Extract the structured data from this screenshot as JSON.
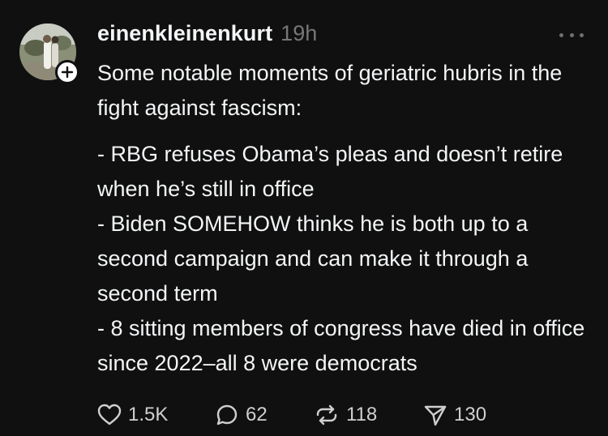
{
  "post": {
    "username": "einenkleinenkurt",
    "timestamp": "19h",
    "text": {
      "intro": "Some notable moments of geriatric hubris in the fight against fascism:",
      "items": [
        "- RBG refuses Obama’s pleas and doesn’t retire when he’s still in office",
        "- Biden SOMEHOW thinks he is both up to a second campaign and can make it through a second term",
        "- 8 sitting members of congress have died in office since 2022–all 8 were democrats"
      ]
    },
    "actions": {
      "likes": "1.5K",
      "replies": "62",
      "reposts": "118",
      "shares": "130"
    }
  },
  "icons": {
    "more": "more-dots-icon",
    "follow": "plus-icon",
    "like": "heart-icon",
    "reply": "comment-bubble-icon",
    "repost": "repost-icon",
    "share": "send-icon"
  },
  "colors": {
    "background": "#101010",
    "text": "#f3f5f7",
    "muted": "#777777"
  }
}
